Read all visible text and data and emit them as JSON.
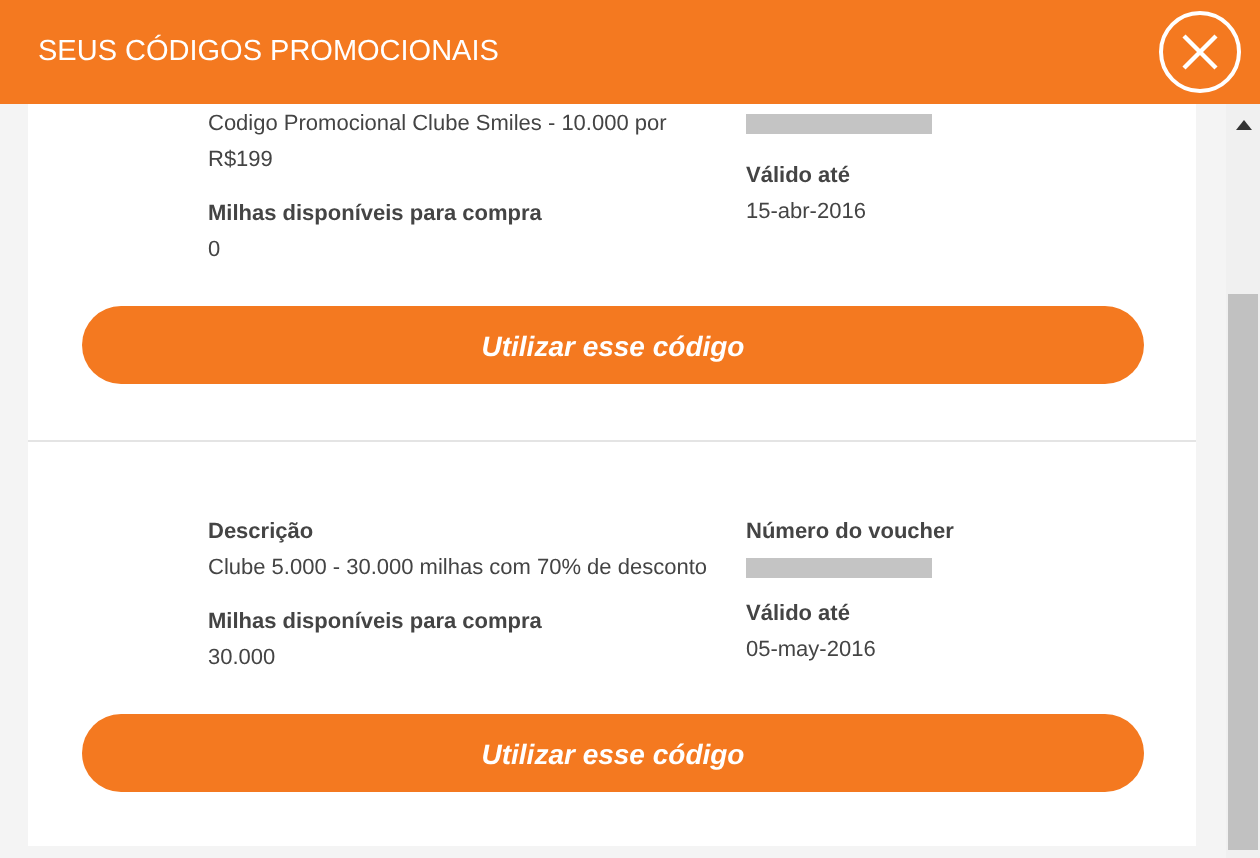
{
  "header": {
    "title": "SEUS CÓDIGOS PROMOCIONAIS"
  },
  "codes": [
    {
      "description": "Codigo Promocional Clube Smiles - 10.000 por R$199",
      "miles_label": "Milhas disponíveis para compra",
      "miles": "0",
      "valid_label": "Válido até",
      "valid_until": "15-abr-2016",
      "button": "Utilizar esse código"
    },
    {
      "description_label": "Descrição",
      "description": "Clube 5.000 - 30.000 milhas com 70% de desconto",
      "voucher_label": "Número do voucher",
      "miles_label": "Milhas disponíveis para compra",
      "miles": "30.000",
      "valid_label": "Válido até",
      "valid_until": "05-may-2016",
      "button": "Utilizar esse código"
    }
  ]
}
